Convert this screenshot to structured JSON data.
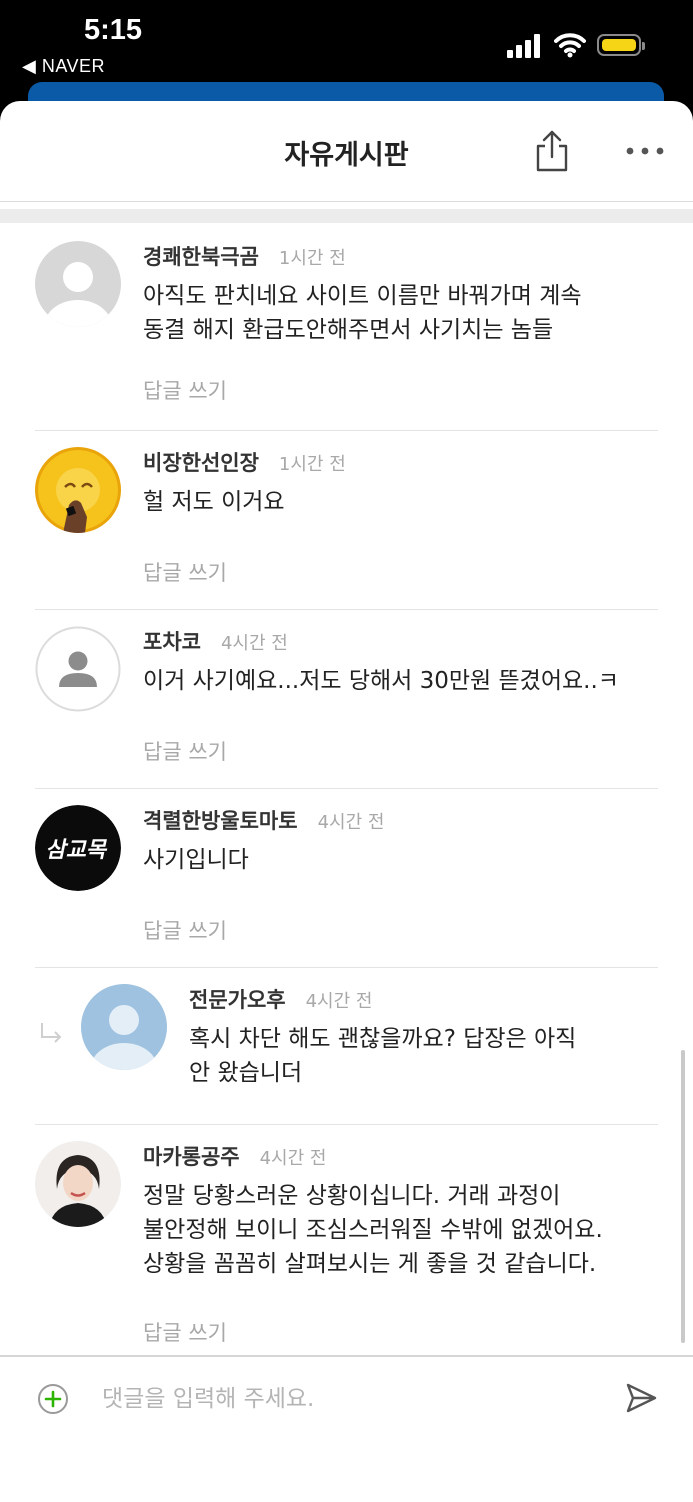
{
  "status_bar": {
    "time": "5:15",
    "back_app": "◀ NAVER"
  },
  "header": {
    "title": "자유게시판"
  },
  "comments": [
    {
      "name": "경쾌한북극곰",
      "time": "1시간 전",
      "text": "아직도 판치네요 사이트 이름만 바꿔가며 계속\n동결 해지 환급도안해주면서  사기치는 놈들",
      "reply": "답글 쓰기"
    },
    {
      "name": "비장한선인장",
      "time": "1시간 전",
      "text": "헐 저도 이거요",
      "reply": "답글 쓰기"
    },
    {
      "name": "포차코",
      "time": "4시간 전",
      "text": "이거 사기예요...저도 당해서 30만원 뜯겼어요..ㅋ",
      "reply": "답글 쓰기"
    },
    {
      "name": "격렬한방울토마토",
      "time": "4시간 전",
      "text": "사기입니다",
      "reply": "답글 쓰기",
      "avatar_text": "삼교목"
    },
    {
      "name": "전문가오후",
      "time": "4시간 전",
      "text": "혹시 차단 해도 괜찮을까요? 답장은 아직\n안 왔습니더"
    },
    {
      "name": "마카롱공주",
      "time": "4시간 전",
      "text": "정말 당황스러운 상황이십니다. 거래 과정이\n불안정해 보이니 조심스러워질 수밖에 없겠어요.\n상황을 꼼꼼히 살펴보시는 게 좋을 것 같습니다.",
      "reply": "답글 쓰기"
    }
  ],
  "input": {
    "placeholder": "댓글을 입력해 주세요."
  },
  "colors": {
    "accent_green": "#2db400",
    "nav_blue": "#0a5aa8",
    "battery_yellow": "#f5d516"
  }
}
